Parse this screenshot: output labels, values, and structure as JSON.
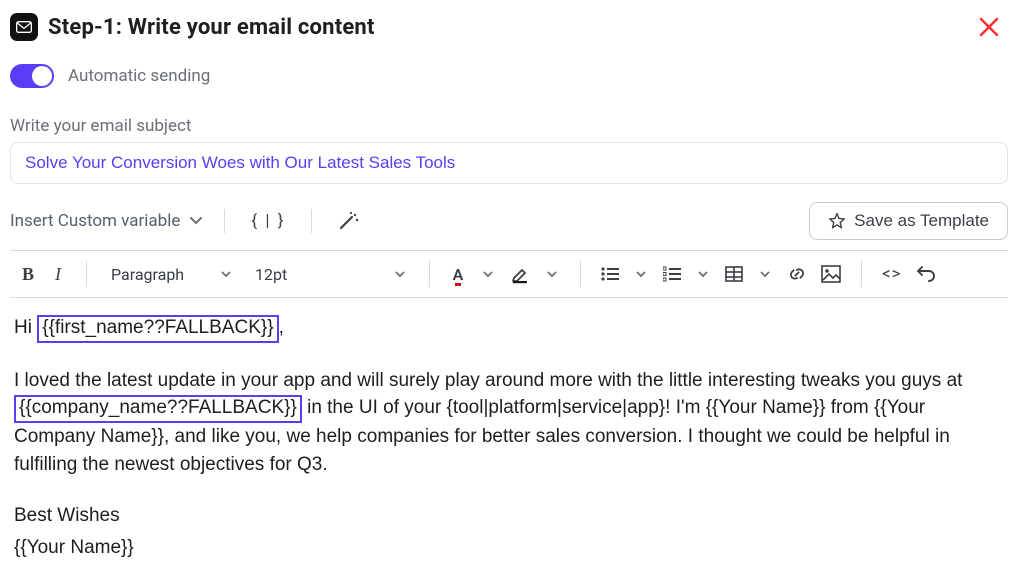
{
  "header": {
    "title": "Step-1:  Write your email content"
  },
  "toggle": {
    "label": "Automatic sending"
  },
  "subject": {
    "label": "Write your email subject",
    "value": "Solve Your Conversion Woes with Our Latest Sales Tools"
  },
  "toolbar1": {
    "custom_var_label": "Insert Custom variable",
    "braces_label": "{ | }",
    "save_template_label": "Save as Template"
  },
  "toolbar2": {
    "paragraph_label": "Paragraph",
    "fontsize_label": "12pt",
    "font_color_letter": "A",
    "code_label": "<>"
  },
  "body": {
    "hi_prefix": "Hi ",
    "chip_firstname": "{{first_name??FALLBACK}}",
    "hi_suffix": ",",
    "p2_a": "I loved the latest update in your app and will surely play around more with the little interesting tweaks you guys at ",
    "chip_company": "{{company_name??FALLBACK}}",
    "p2_b": " in the UI of your {tool|platform|service|app}! I'm {{Your Name}} from {{Your Company Name}}, and like you, we help companies for better sales conversion. I thought we could be helpful in fulfilling the newest objectives for Q3.",
    "signoff1": "Best Wishes",
    "signoff2": "{{Your Name}}"
  }
}
